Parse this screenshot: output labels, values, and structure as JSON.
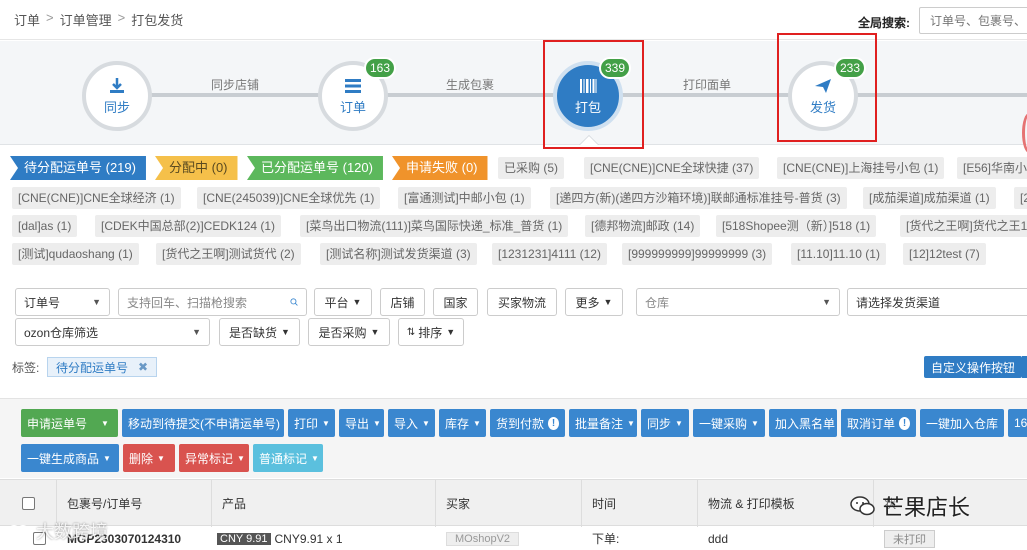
{
  "breadcrumb": [
    "订单",
    "订单管理",
    "打包发货"
  ],
  "breadcrumb_sep": ">",
  "global_search": {
    "label": "全局搜索:",
    "placeholder": "订单号、包裹号、"
  },
  "flow": {
    "nodes": [
      {
        "label": "同步",
        "badge": ""
      },
      {
        "label": "订单",
        "badge": "163"
      },
      {
        "label": "打包",
        "badge": "339"
      },
      {
        "label": "发货",
        "badge": "233"
      }
    ],
    "edges": [
      "同步店铺",
      "生成包裹",
      "打印面单"
    ]
  },
  "status_tabs": [
    {
      "label": "待分配运单号 (219)"
    },
    {
      "label": "分配中 (0)"
    },
    {
      "label": "已分配运单号 (120)"
    },
    {
      "label": "申请失败 (0)"
    }
  ],
  "channel_tags": {
    "row1": [
      "已采购 (5)",
      "[CNE(CNE)]CNE全球快捷 (37)",
      "[CNE(CNE)]上海挂号小包 (1)",
      "[E56]华南小"
    ],
    "row2": [
      "[CNE(CNE)]CNE全球经济 (1)",
      "[CNE(245039)]CNE全球优先 (1)",
      "[富通测试]中邮小包 (1)",
      "[递四方(新)(递四方沙箱环境)]联邮通标准挂号-普货 (3)",
      "[成茄渠道]成茄渠道 (1)",
      "[2"
    ],
    "row3": [
      "[dal]as (1)",
      "[CDEK中国总部(2)]CEDK124 (1)",
      "[菜鸟出口物流(111)]菜鸟国际快递_标准_普货 (1)",
      "[德邦物流]邮政 (14)",
      "[518Shopee测（新）]518 (1)",
      "[货代之王啊]货代之王1"
    ],
    "row4": [
      "[测试]qudaoshang (1)",
      "[货代之王啊]测试货代 (2)",
      "[测试名称]测试发货渠道 (3)",
      "[1231231]4111 (12)",
      "[999999999]99999999 (3)",
      "[11.10]11.10 (1)",
      "[12]12test (7)"
    ]
  },
  "filters": {
    "order_no_select": "订单号",
    "search_placeholder": "支持回车、扫描枪搜索",
    "platform": "平台",
    "store": "店铺",
    "country": "国家",
    "buyer_logistics": "买家物流",
    "more": "更多",
    "warehouse_placeholder": "仓库",
    "channel_placeholder": "请选择发货渠道",
    "ozon": "ozon仓库筛选",
    "out_of_stock": "是否缺货",
    "purchased": "是否采购",
    "sort": "排序"
  },
  "labels": {
    "title": "标签:",
    "chip": "待分配运单号",
    "chip_close": "✖",
    "custom_btn": "自定义操作按钮"
  },
  "toolbar": {
    "row1": [
      "申请运单号",
      "移动到待提交(不申请运单号)",
      "打印",
      "导出",
      "导入",
      "库存",
      "货到付款",
      "批量备注",
      "同步",
      "一键采购",
      "加入黑名单",
      "取消订单",
      "一键加入仓库",
      "16"
    ],
    "row2": [
      "一键生成商品",
      "删除",
      "异常标记",
      "普通标记"
    ]
  },
  "table": {
    "headers": [
      "包裹号/订单号",
      "产品",
      "买家",
      "时间",
      "物流 & 打印模板",
      "状"
    ],
    "row": {
      "package_no": "MGP2303070124310",
      "cny_tag": "CNY 9.91",
      "product": "CNY9.91 x 1",
      "buyer": "MOshopV2",
      "time": "下单:",
      "logistics": "ddd",
      "status": "未打印"
    }
  },
  "watermarks": {
    "left": "大数跨境",
    "right": "芒果店长"
  },
  "colors": {
    "primary": "#2f7cc4",
    "badge_green": "#43a047",
    "highlight_red": "#e02020"
  }
}
